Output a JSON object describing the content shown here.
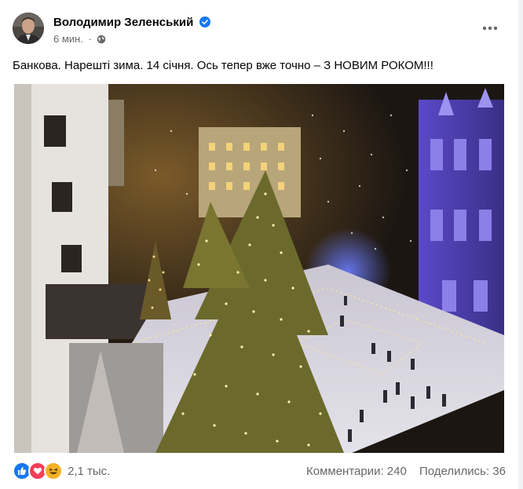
{
  "post": {
    "author": "Володимир Зеленський",
    "time": "6 мин.",
    "separator": "·",
    "text": "Банкова. Нарешті зима. 14 січня. Ось тепер вже точно – З НОВИМ РОКОМ!!!",
    "icons": {
      "verified": "verified-badge-icon",
      "audience": "globe-icon",
      "menu": "more-dots-icon"
    }
  },
  "footer": {
    "reaction_count": "2,1 тыс.",
    "reactions": [
      "like",
      "love",
      "haha"
    ],
    "comments": "Комментарии: 240",
    "shares": "Поделились: 36"
  },
  "colors": {
    "accent": "#1877f2",
    "love": "#f33e58",
    "haha": "#f7b125",
    "muted": "#65676b"
  }
}
